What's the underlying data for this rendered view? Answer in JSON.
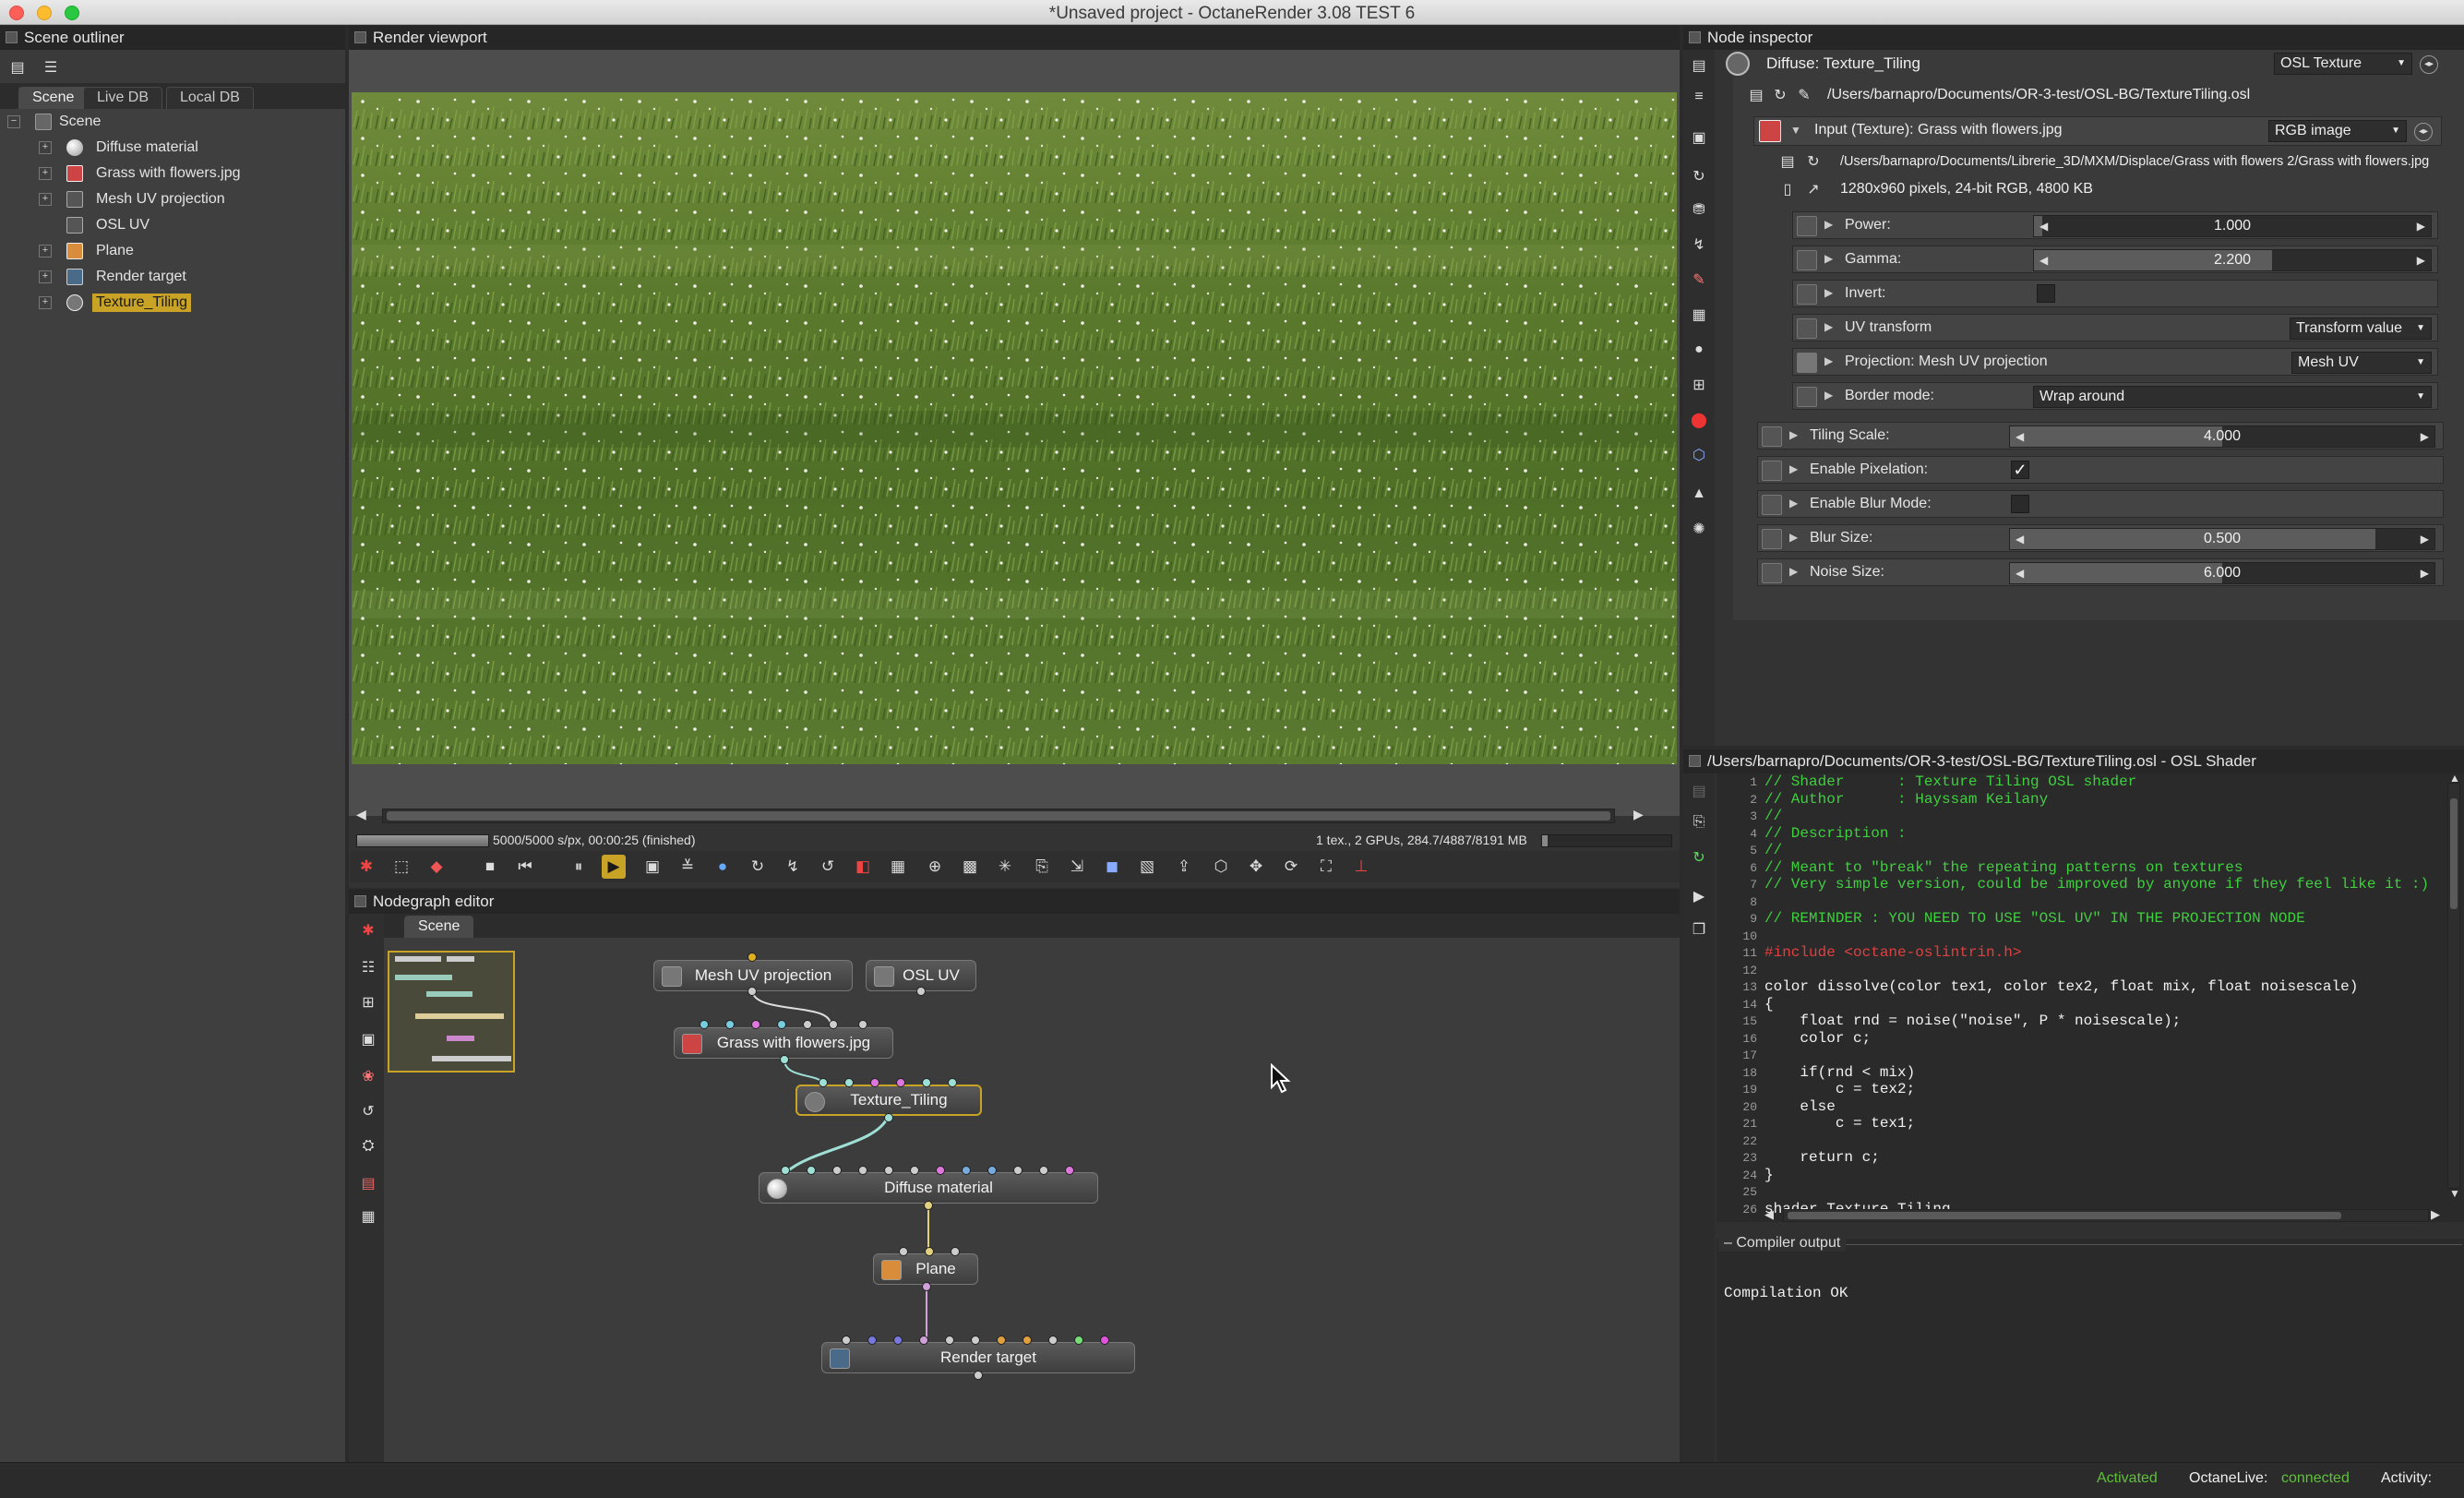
{
  "window": {
    "title": "*Unsaved project - OctaneRender 3.08 TEST 6"
  },
  "scene_outliner": {
    "header": "Scene outliner",
    "tabs": [
      "Scene",
      "Live DB",
      "Local DB"
    ],
    "root": "Scene",
    "items": [
      {
        "label": "Diffuse material",
        "expandable": true
      },
      {
        "label": "Grass with flowers.jpg",
        "expandable": true
      },
      {
        "label": "Mesh UV projection",
        "expandable": true
      },
      {
        "label": "OSL UV",
        "expandable": false
      },
      {
        "label": "Plane",
        "expandable": true
      },
      {
        "label": "Render target",
        "expandable": true
      },
      {
        "label": "Texture_Tiling",
        "expandable": true,
        "selected": true
      }
    ]
  },
  "render_viewport": {
    "header": "Render viewport",
    "status_left": "5000/5000 s/px, 00:00:25 (finished)",
    "status_right": "1 tex., 2 GPUs, 284.7/4887/8191 MB",
    "progress": 1.0
  },
  "nodegraph": {
    "header": "Nodegraph editor",
    "tab": "Scene",
    "nodes": {
      "mesh_uv": "Mesh UV projection",
      "osl_uv": "OSL UV",
      "grass": "Grass with flowers.jpg",
      "texture_tiling": "Texture_Tiling",
      "diffuse": "Diffuse material",
      "plane": "Plane",
      "render_target": "Render target"
    }
  },
  "node_inspector": {
    "header": "Node inspector",
    "node_title": "Diffuse: Texture_Tiling",
    "node_type": "OSL Texture",
    "file_path": "/Users/barnapro/Documents/OR-3-test/OSL-BG/TextureTiling.osl",
    "input_label": "Input (Texture): Grass with flowers.jpg",
    "input_type": "RGB image",
    "image_path": "/Users/barnapro/Documents/Librerie_3D/MXM/Displace/Grass with flowers 2/Grass with flowers.jpg",
    "image_info": "1280x960 pixels, 24-bit RGB, 4800 KB",
    "params": {
      "power_label": "Power:",
      "power_value": "1.000",
      "gamma_label": "Gamma:",
      "gamma_value": "2.200",
      "invert_label": "Invert:",
      "uv_transform_label": "UV transform",
      "uv_transform_value": "Transform value",
      "projection_label": "Projection: Mesh UV projection",
      "projection_value": "Mesh UV",
      "border_label": "Border mode:",
      "border_value": "Wrap around",
      "tiling_label": "Tiling Scale:",
      "tiling_value": "4.000",
      "pixelation_label": "Enable Pixelation:",
      "blur_mode_label": "Enable Blur Mode:",
      "blur_size_label": "Blur Size:",
      "blur_size_value": "0.500",
      "noise_size_label": "Noise Size:",
      "noise_size_value": "6.000"
    },
    "slider_fill": {
      "power": 0.02,
      "gamma": 0.6,
      "tiling": 0.5,
      "blur_size": 0.86,
      "noise_size": 0.5
    },
    "pixelation_checked": true,
    "blur_mode_checked": false,
    "invert_checked": false
  },
  "osl_shader": {
    "header": "/Users/barnapro/Documents/OR-3-test/OSL-BG/TextureTiling.osl - OSL Shader",
    "lines": [
      {
        "n": "1",
        "text": "// Shader      : Texture Tiling OSL shader",
        "type": "comment"
      },
      {
        "n": "2",
        "text": "// Author      : Hayssam Keilany",
        "type": "comment"
      },
      {
        "n": "3",
        "text": "//",
        "type": "comment"
      },
      {
        "n": "4",
        "text": "// Description :",
        "type": "comment"
      },
      {
        "n": "5",
        "text": "//",
        "type": "comment"
      },
      {
        "n": "6",
        "text": "// Meant to \"break\" the repeating patterns on textures",
        "type": "comment"
      },
      {
        "n": "7",
        "text": "// Very simple version, could be improved by anyone if they feel like it :)",
        "type": "comment"
      },
      {
        "n": "8",
        "text": "",
        "type": "code"
      },
      {
        "n": "9",
        "text": "// REMINDER : YOU NEED TO USE \"OSL UV\" IN THE PROJECTION NODE",
        "type": "comment"
      },
      {
        "n": "10",
        "text": "",
        "type": "code"
      },
      {
        "n": "11",
        "text": "#include <octane-oslintrin.h>",
        "type": "preproc"
      },
      {
        "n": "12",
        "text": "",
        "type": "code"
      },
      {
        "n": "13",
        "text": "color dissolve(color tex1, color tex2, float mix, float noisescale)",
        "type": "code"
      },
      {
        "n": "14",
        "text": "{",
        "type": "code"
      },
      {
        "n": "15",
        "text": "    float rnd = noise(\"noise\", P * noisescale);",
        "type": "code"
      },
      {
        "n": "16",
        "text": "    color c;",
        "type": "code"
      },
      {
        "n": "17",
        "text": "",
        "type": "code"
      },
      {
        "n": "18",
        "text": "    if(rnd < mix)",
        "type": "code"
      },
      {
        "n": "19",
        "text": "        c = tex2;",
        "type": "code"
      },
      {
        "n": "20",
        "text": "    else",
        "type": "code"
      },
      {
        "n": "21",
        "text": "        c = tex1;",
        "type": "code"
      },
      {
        "n": "22",
        "text": "",
        "type": "code"
      },
      {
        "n": "23",
        "text": "    return c;",
        "type": "code"
      },
      {
        "n": "24",
        "text": "}",
        "type": "code"
      },
      {
        "n": "25",
        "text": "",
        "type": "code"
      },
      {
        "n": "26",
        "text": "shader Texture_Tiling",
        "type": "code"
      }
    ],
    "compiler_header": "Compiler output",
    "compiler_result": "Compilation OK"
  },
  "status_bar": {
    "activated": "Activated",
    "octane_live_label": "OctaneLive:",
    "octane_live_value": "connected",
    "activity_label": "Activity:"
  },
  "colors": {
    "accent_selected": "#c9a326",
    "comment_green": "#3fcf3f",
    "preproc_red": "#e04040",
    "status_green": "#5fc03a"
  }
}
